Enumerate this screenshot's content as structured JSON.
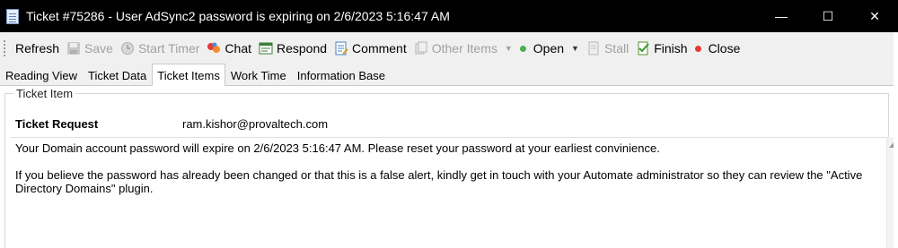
{
  "window": {
    "title": "Ticket #75286 - User AdSync2 password is expiring on 2/6/2023 5:16:47 AM",
    "minimize_glyph": "—",
    "maximize_glyph": "☐",
    "close_glyph": "✕"
  },
  "toolbar": {
    "refresh": "Refresh",
    "save": "Save",
    "start_timer": "Start Timer",
    "chat": "Chat",
    "respond": "Respond",
    "comment": "Comment",
    "other_items": "Other Items",
    "open": "Open",
    "stall": "Stall",
    "finish": "Finish",
    "close": "Close",
    "dropdown_glyph": "▼"
  },
  "tabs": [
    "Reading View",
    "Ticket Data",
    "Ticket Items",
    "Work Time",
    "Information Base"
  ],
  "active_tab": "Ticket Items",
  "ticket_item": {
    "group_label": "Ticket Item",
    "request_label": "Ticket Request",
    "requester_email": "ram.kishor@provaltech.com",
    "message": "Your Domain account password will expire on 2/6/2023 5:16:47 AM. Please reset your password at your earliest convinience.\n\nIf you believe the password has already been changed or that this is a false alert, kindly get in touch with your Automate administrator so they can review the \"Active Directory Domains\" plugin."
  },
  "colors": {
    "titlebar_bg": "#000000",
    "open_dot": "#4caf50",
    "close_dot": "#e53935",
    "disabled_text": "#a0a0a0"
  }
}
